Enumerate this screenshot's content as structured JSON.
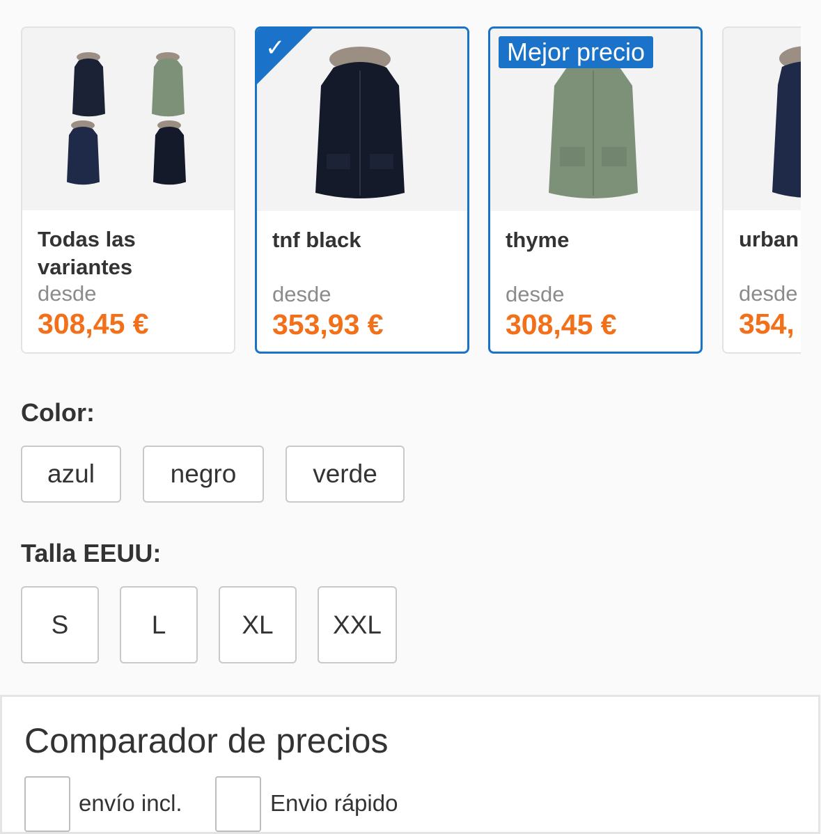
{
  "variants": [
    {
      "name": "Todas las variantes",
      "desde": "desde",
      "price": "308,45 €",
      "selected": false
    },
    {
      "name": "tnf black",
      "desde": "desde",
      "price": "353,93 €",
      "selected": true
    },
    {
      "name": "thyme",
      "desde": "desde",
      "price": "308,45 €",
      "selected": true,
      "badge": "Mejor precio"
    },
    {
      "name": "urban",
      "desde": "desde",
      "price": "354,",
      "selected": false
    }
  ],
  "color": {
    "label": "Color:",
    "options": [
      "azul",
      "negro",
      "verde"
    ]
  },
  "size": {
    "label": "Talla EEUU:",
    "options": [
      "S",
      "L",
      "XL",
      "XXL"
    ]
  },
  "comparator": {
    "title": "Comparador de precios",
    "filters": [
      "envío incl.",
      "Envio rápido"
    ]
  },
  "colors": {
    "accent": "#1a73c8",
    "price": "#f2701a",
    "navy": "#1b2236",
    "thyme": "#7d9179"
  }
}
